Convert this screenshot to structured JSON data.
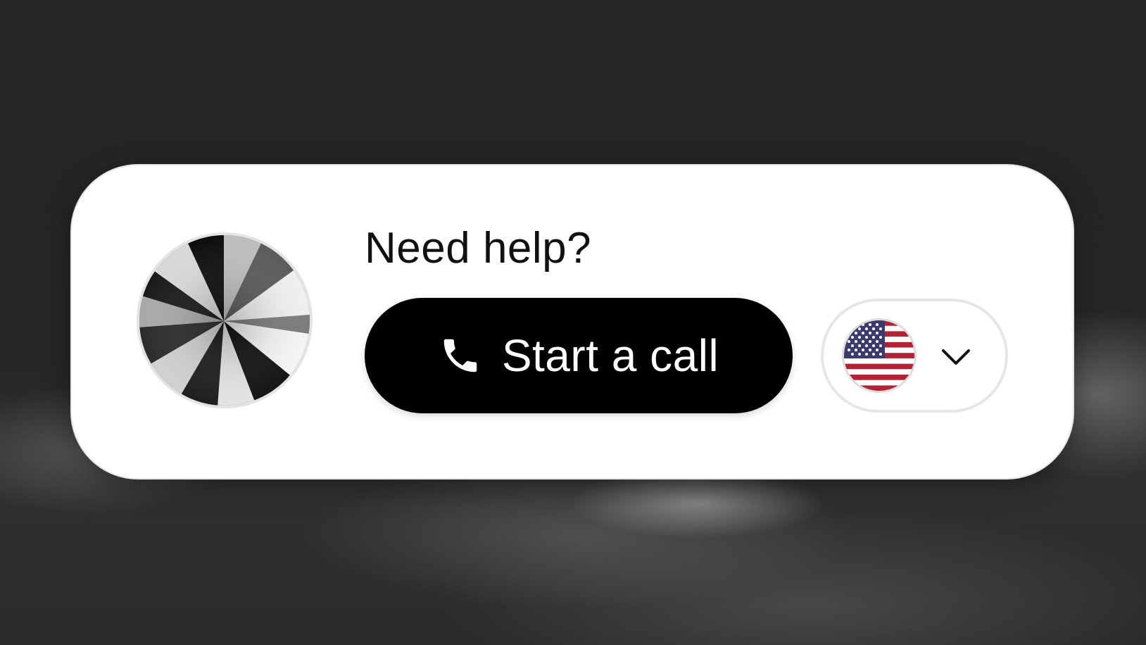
{
  "widget": {
    "heading": "Need help?",
    "call_button_label": "Start a call",
    "avatar_icon": "agent-avatar-orb",
    "call_icon": "phone-icon",
    "language": {
      "selected_flag": "us-flag-icon",
      "dropdown_icon": "chevron-down-icon"
    }
  },
  "colors": {
    "card_background": "#ffffff",
    "button_background": "#000000",
    "button_text": "#ffffff",
    "page_background": "#262626",
    "flag_red": "#b22234",
    "flag_blue": "#3c3b6e"
  }
}
